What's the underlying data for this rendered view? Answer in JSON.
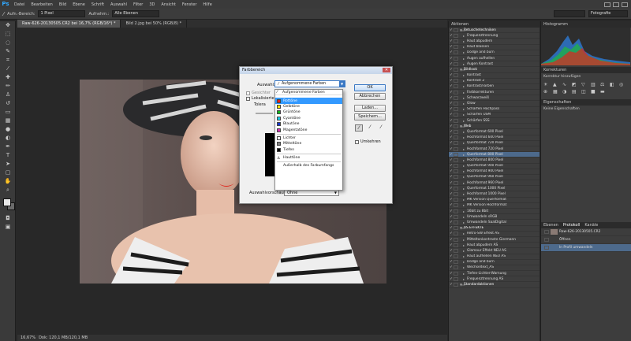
{
  "menubar": {
    "logo": "Ps",
    "items": [
      "Datei",
      "Bearbeiten",
      "Bild",
      "Ebene",
      "Schrift",
      "Auswahl",
      "Filter",
      "3D",
      "Ansicht",
      "Fenster",
      "Hilfe"
    ]
  },
  "optionsbar": {
    "sample_label": "Aufn.-Bereich:",
    "sample_value": "1 Pixel",
    "layer_label": "Aufnehm.:",
    "layer_value": "Alle Ebenen",
    "workspace": "Fotografie"
  },
  "tabs": [
    {
      "label": "Raw-626-20130505.CR2 bei 16,7% (RGB/16*) *",
      "active": true
    },
    {
      "label": "Bild 2.jpg bei 50% (RGB/8) *",
      "active": false
    }
  ],
  "statusbar": {
    "zoom": "16,67%",
    "doc": "Dok: 120,1 MB/120,1 MB"
  },
  "dialog": {
    "title": "Farbbereich",
    "select_label": "Auswahl:",
    "select_value": "Aufgenommene Farben",
    "localized_label": "Lokalisierte",
    "tolerance_label": "Tolera",
    "gesichter_label": "Gesichter",
    "preview_label": "Auswahlvorschau:",
    "preview_value": "Ohne",
    "ok": "OK",
    "cancel": "Abbrechen",
    "load": "Laden...",
    "save": "Speichern...",
    "invert": "Umkehren"
  },
  "dropdown": {
    "top": "Aufgenommene Farben",
    "colors": [
      {
        "label": "Rottöne",
        "color": "#e8201a",
        "selected": true
      },
      {
        "label": "Gelbtöne",
        "color": "#f5e400",
        "selected": false
      },
      {
        "label": "Grüntöne",
        "color": "#13b21b",
        "selected": false
      },
      {
        "label": "Cyantöne",
        "color": "#19c8e6",
        "selected": false
      },
      {
        "label": "Blautöne",
        "color": "#1535c8",
        "selected": false
      },
      {
        "label": "Magentatöne",
        "color": "#cc2fb0",
        "selected": false
      }
    ],
    "tones": [
      {
        "label": "Lichter",
        "color": "#ffffff"
      },
      {
        "label": "Mitteltöne",
        "color": "#808080"
      },
      {
        "label": "Tiefen",
        "color": "#000000"
      }
    ],
    "skin": "Hauttöne",
    "gamut": "Außerhalb des Farbumfangs"
  },
  "actions": {
    "header": "Aktionen",
    "rows": [
      {
        "label": "Retuschetechniken",
        "folder": true
      },
      {
        "label": "Frequenztrennung"
      },
      {
        "label": "Haut abpudern"
      },
      {
        "label": "Haut blassen"
      },
      {
        "label": "Dodge and burn"
      },
      {
        "label": "Augen aufhellen"
      },
      {
        "label": "Augen Kontrast"
      },
      {
        "label": "Bildlook",
        "folder": true
      },
      {
        "label": "Kontrast"
      },
      {
        "label": "Kontrast 2"
      },
      {
        "label": "Kontrast/Farben"
      },
      {
        "label": "Farbkorrekturen"
      },
      {
        "label": "Schwarzweiß"
      },
      {
        "label": "Glow"
      },
      {
        "label": "Schärfen Hochpass"
      },
      {
        "label": "Schärfen USM"
      },
      {
        "label": "Schärfen SSS"
      },
      {
        "label": "Web",
        "folder": true
      },
      {
        "label": "Querformat 600 Pixel"
      },
      {
        "label": "Hochformat 600 Pixel"
      },
      {
        "label": "Querformat 720 Pixel"
      },
      {
        "label": "Hochformat 720 Pixel"
      },
      {
        "label": "Querformat 800 Pixel",
        "selected": true
      },
      {
        "label": "Hochformat 800 Pixel"
      },
      {
        "label": "Querformat 900 Pixel"
      },
      {
        "label": "Hochformat 900 Pixel"
      },
      {
        "label": "Querformat 960 Pixel"
      },
      {
        "label": "Hochformat 960 Pixel"
      },
      {
        "label": "Querformat 1000 Pixel"
      },
      {
        "label": "Hochformat 1000 Pixel"
      },
      {
        "label": "MK Version Querformat"
      },
      {
        "label": "MK Version Hochformat"
      },
      {
        "label": "16bit zu 8bit"
      },
      {
        "label": "Umwandeln sRGB"
      },
      {
        "label": "Umwandeln SaalDigital"
      },
      {
        "label": "AS EFFEKTE",
        "folder": true
      },
      {
        "label": "Retro-SW Effekt AS"
      },
      {
        "label": "Mitteltonkontraste Giermann"
      },
      {
        "label": "Haut abpudern AS"
      },
      {
        "label": "Glamour Effekt NEU AS"
      },
      {
        "label": "Haut aufhellen NEU AS"
      },
      {
        "label": "Dodge and burn"
      },
      {
        "label": "Wechseltext_AS"
      },
      {
        "label": "Tiefen-Lichter-Warnung"
      },
      {
        "label": "Frequenztrennung AS"
      },
      {
        "label": "Standardaktionen",
        "folder": true
      }
    ]
  },
  "right": {
    "histogram": "Histogramm",
    "adjustments": "Korrekturen",
    "add_adjustment": "Korrektur hinzufügen",
    "properties": "Eigenschaften",
    "no_properties": "Keine Eigenschaften",
    "history_tabs": [
      "Ebenen",
      "Protokoll",
      "Kanäle"
    ],
    "history": [
      {
        "label": "Raw-626-20130505.CR2"
      },
      {
        "label": "Öffnen"
      },
      {
        "label": "In Profil umwandeln",
        "selected": true
      }
    ]
  }
}
